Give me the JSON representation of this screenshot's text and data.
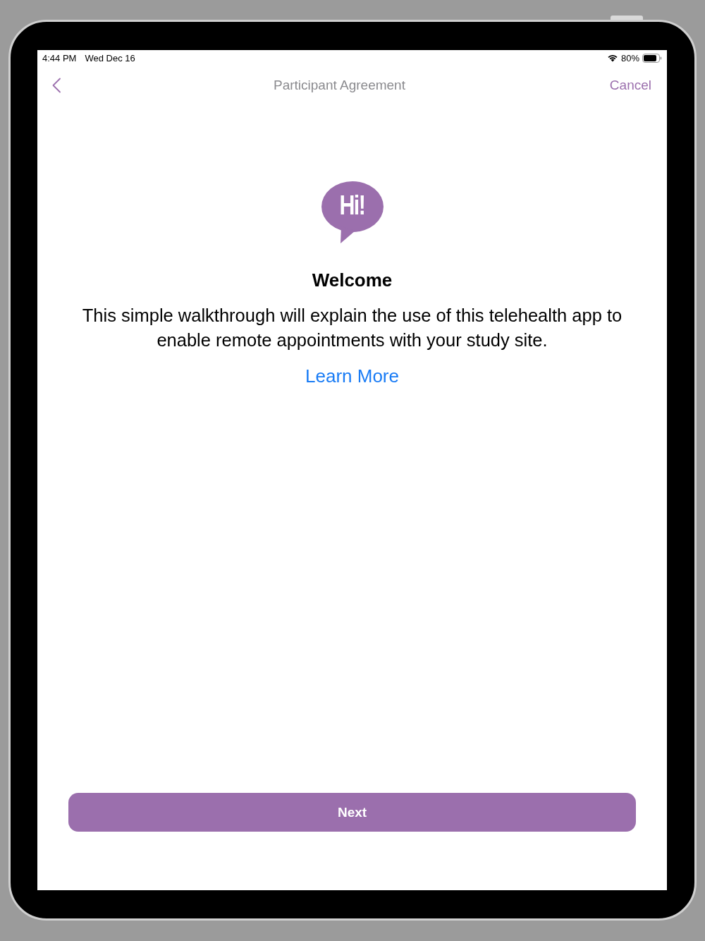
{
  "status_bar": {
    "time": "4:44 PM",
    "date": "Wed Dec 16",
    "battery": "80%"
  },
  "nav_bar": {
    "title": "Participant Agreement",
    "cancel": "Cancel"
  },
  "content": {
    "logo_text": "Hi!",
    "heading": "Welcome",
    "body": "This simple walkthrough will explain the use of this telehealth app to enable remote appointments with your study site.",
    "link": "Learn More"
  },
  "footer": {
    "button": "Next"
  }
}
